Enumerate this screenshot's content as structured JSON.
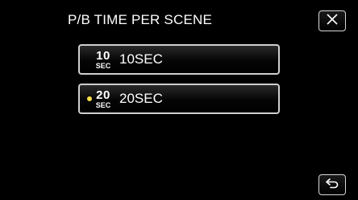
{
  "header": {
    "title": "P/B TIME PER SCENE"
  },
  "options": [
    {
      "icon_number": "10",
      "icon_unit": "SEC",
      "label": "10SEC",
      "selected": false
    },
    {
      "icon_number": "20",
      "icon_unit": "SEC",
      "label": "20SEC",
      "selected": true
    }
  ],
  "icons": {
    "close": "close-icon",
    "back": "return-arrow-icon",
    "selected_marker": "selected-dot-icon"
  },
  "colors": {
    "background": "#000000",
    "text": "#ffffff",
    "button_border": "#cfcfcf",
    "selected_marker": "#ffe14a"
  }
}
